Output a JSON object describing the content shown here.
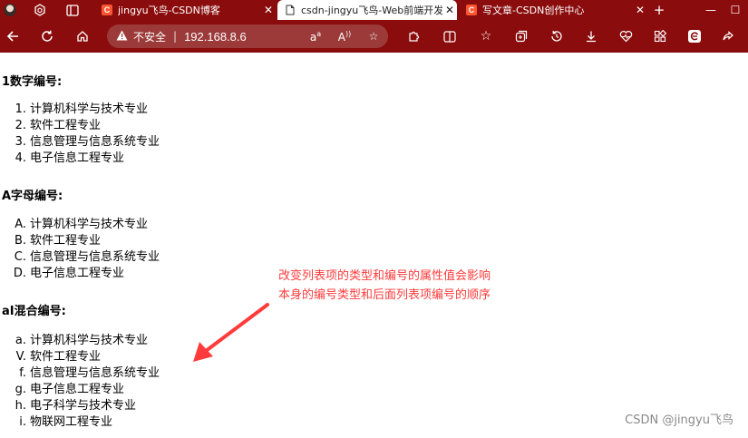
{
  "browser": {
    "tabs": [
      {
        "title": "jingyu飞鸟-CSDN博客",
        "active": false,
        "favicon": "csdn-icon"
      },
      {
        "title": "csdn-jingyu飞鸟-Web前端开发",
        "active": true,
        "favicon": "document-icon"
      },
      {
        "title": "写文章-CSDN创作中心",
        "active": false,
        "favicon": "csdn-icon"
      }
    ],
    "security_label": "不安全",
    "url": "192.168.8.6",
    "read_aloud_label": "A⁾",
    "translate_label": "aᴬ"
  },
  "page": {
    "section1": {
      "heading": "1数字编号:",
      "items": [
        {
          "marker": "1.",
          "text": "计算机科学与技术专业"
        },
        {
          "marker": "2.",
          "text": "软件工程专业"
        },
        {
          "marker": "3.",
          "text": "信息管理与信息系统专业"
        },
        {
          "marker": "4.",
          "text": "电子信息工程专业"
        }
      ]
    },
    "section2": {
      "heading": "A字母编号:",
      "items": [
        {
          "marker": "A.",
          "text": "计算机科学与技术专业"
        },
        {
          "marker": "B.",
          "text": "软件工程专业"
        },
        {
          "marker": "C.",
          "text": "信息管理与信息系统专业"
        },
        {
          "marker": "D.",
          "text": "电子信息工程专业"
        }
      ]
    },
    "section3": {
      "heading": "aI混合编号:",
      "items": [
        {
          "marker": "a.",
          "text": "计算机科学与技术专业"
        },
        {
          "marker": "V.",
          "text": "软件工程专业"
        },
        {
          "marker": "f.",
          "text": "信息管理与信息系统专业"
        },
        {
          "marker": "g.",
          "text": "电子信息工程专业"
        },
        {
          "marker": "h.",
          "text": "电子科学与技术专业"
        },
        {
          "marker": "i.",
          "text": "物联网工程专业"
        }
      ]
    },
    "annotation": {
      "line1": "改变列表项的类型和编号的属性值会影响",
      "line2": "本身的编号类型和后面列表项编号的顺序",
      "color": "#ff3b3b"
    },
    "watermark": "CSDN @jingyu飞鸟"
  },
  "colors": {
    "browser_chrome": "#8a0c0c",
    "csdn_brand": "#fc5531"
  }
}
